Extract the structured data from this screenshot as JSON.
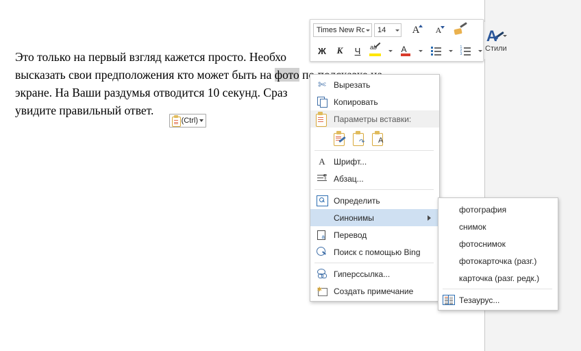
{
  "document": {
    "lines": [
      [
        {
          "t": "Это только на первый взгляд кажется просто. Необхо",
          "sel": false
        }
      ],
      [
        {
          "t": "высказать свои предположения кто может быть на ",
          "sel": false
        },
        {
          "t": "фото",
          "sel": true
        },
        {
          "t": " по подсказке на",
          "sel": false
        }
      ],
      [
        {
          "t": "экране. На Ваши раздумья отводится 10 секунд. Сраз",
          "sel": false
        }
      ],
      [
        {
          "t": "увидите правильный ответ.",
          "sel": false
        }
      ]
    ]
  },
  "paste_button": {
    "label": "(Ctrl)",
    "icon": "clipboard-icon",
    "caret": "chevron-down-icon"
  },
  "mini_toolbar": {
    "font_name": "Times New Ror",
    "font_size": "14",
    "grow_font": "A",
    "shrink_font": "A",
    "format_painter": "format-painter-icon",
    "bold": "Ж",
    "italic": "К",
    "underline": "Ч",
    "highlight": "ab",
    "font_color": "A",
    "bullets": "bullet-list-icon",
    "numbering": "numbered-list-icon",
    "styles_label": "Стили"
  },
  "context_menu": {
    "items": [
      {
        "id": "cut",
        "label": "Вырезать",
        "icon": "scissors-icon",
        "type": "item"
      },
      {
        "id": "copy",
        "label": "Копировать",
        "icon": "copy-icon",
        "type": "item"
      },
      {
        "id": "paste_header",
        "label": "Параметры вставки:",
        "icon": "clipboard-icon",
        "type": "header"
      },
      {
        "id": "paste_options",
        "type": "paste-options",
        "options": [
          {
            "id": "keep-source-formatting",
            "icon": "paste-keep-source-icon"
          },
          {
            "id": "merge-formatting",
            "icon": "paste-merge-icon"
          },
          {
            "id": "keep-text-only",
            "icon": "paste-text-only-icon"
          }
        ]
      },
      {
        "id": "sep1",
        "type": "separator"
      },
      {
        "id": "font",
        "label": "Шрифт...",
        "icon": "font-icon",
        "type": "item"
      },
      {
        "id": "paragraph",
        "label": "Абзац...",
        "icon": "paragraph-icon",
        "type": "item"
      },
      {
        "id": "sep2",
        "type": "separator"
      },
      {
        "id": "define",
        "label": "Определить",
        "icon": "define-icon",
        "type": "item"
      },
      {
        "id": "synonyms",
        "label": "Синонимы",
        "icon": "",
        "type": "submenu",
        "selected": true
      },
      {
        "id": "translate",
        "label": "Перевод",
        "icon": "translate-icon",
        "type": "item"
      },
      {
        "id": "bing_search",
        "label": "Поиск с помощью Bing",
        "icon": "bing-search-icon",
        "type": "item"
      },
      {
        "id": "sep3",
        "type": "separator"
      },
      {
        "id": "hyperlink",
        "label": "Гиперссылка...",
        "icon": "hyperlink-icon",
        "type": "item"
      },
      {
        "id": "new_comment",
        "label": "Создать примечание",
        "icon": "new-comment-icon",
        "type": "item"
      }
    ]
  },
  "synonyms_submenu": {
    "items": [
      {
        "id": "s1",
        "label": "фотография"
      },
      {
        "id": "s2",
        "label": "снимок"
      },
      {
        "id": "s3",
        "label": "фотоснимок"
      },
      {
        "id": "s4",
        "label": "фотокарточка (разг.)"
      },
      {
        "id": "s5",
        "label": "карточка (разг. редк.)"
      }
    ],
    "thesaurus": {
      "id": "thesaurus",
      "label": "Тезаурус...",
      "icon": "thesaurus-icon"
    }
  },
  "colors": {
    "accent": "#2b579a",
    "selection_highlight": "#cfe0f2",
    "text_selection": "#d0d0d0",
    "page_background": "#ffffff",
    "app_background": "#f3f3f3"
  }
}
